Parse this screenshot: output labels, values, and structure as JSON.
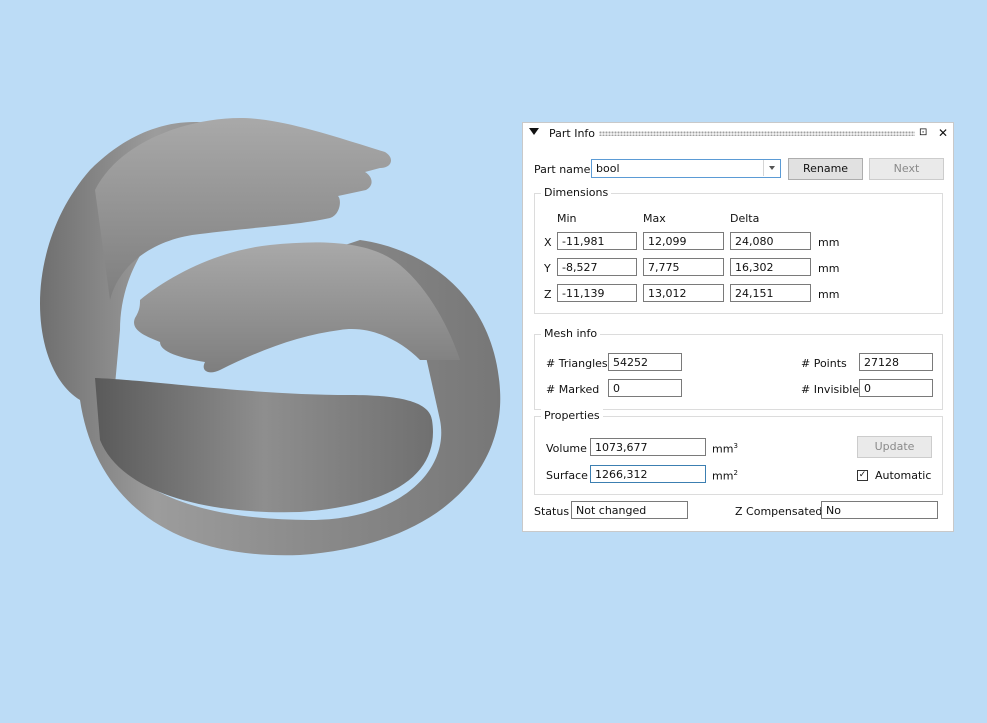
{
  "panel": {
    "title": "Part Info",
    "pin_glyph": "⊡",
    "close_glyph": "✕",
    "part_name_label": "Part name",
    "part_name_value": "bool",
    "rename_label": "Rename",
    "next_label": "Next",
    "dimensions": {
      "title": "Dimensions",
      "col_min": "Min",
      "col_max": "Max",
      "col_delta": "Delta",
      "unit": "mm",
      "rows": [
        {
          "axis": "X",
          "min": "-11,981",
          "max": "12,099",
          "delta": "24,080"
        },
        {
          "axis": "Y",
          "min": "-8,527",
          "max": "7,775",
          "delta": "16,302"
        },
        {
          "axis": "Z",
          "min": "-11,139",
          "max": "13,012",
          "delta": "24,151"
        }
      ]
    },
    "mesh_info": {
      "title": "Mesh info",
      "triangles_label": "# Triangles",
      "triangles_value": "54252",
      "points_label": "# Points",
      "points_value": "27128",
      "marked_label": "# Marked",
      "marked_value": "0",
      "invisible_label": "# Invisible",
      "invisible_value": "0"
    },
    "properties": {
      "title": "Properties",
      "volume_label": "Volume",
      "volume_value": "1073,677",
      "volume_unit": "mm",
      "volume_unit_sup": "3",
      "surface_label": "Surface",
      "surface_value": "1266,312",
      "surface_unit": "mm",
      "surface_unit_sup": "2",
      "update_label": "Update",
      "automatic_label": "Automatic",
      "automatic_checked": true,
      "check_glyph": "✓"
    },
    "status_label": "Status",
    "status_value": "Not changed",
    "z_comp_label": "Z Compensated",
    "z_comp_value": "No"
  },
  "colors": {
    "background": "#bcdcf6",
    "model": "#8a8a8a"
  }
}
